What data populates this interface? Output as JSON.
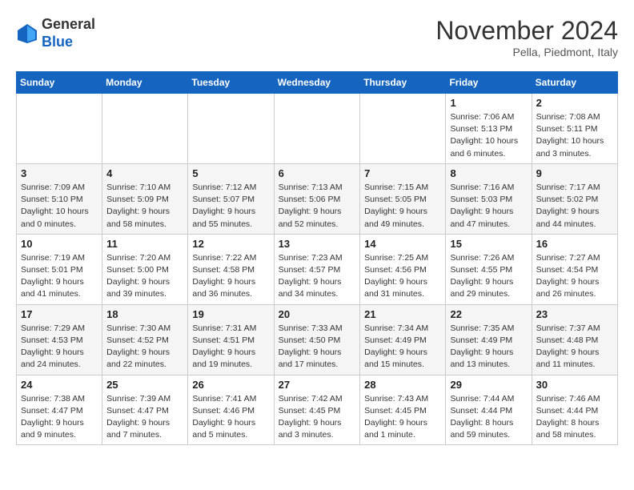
{
  "header": {
    "logo_line1": "General",
    "logo_line2": "Blue",
    "month": "November 2024",
    "location": "Pella, Piedmont, Italy"
  },
  "weekdays": [
    "Sunday",
    "Monday",
    "Tuesday",
    "Wednesday",
    "Thursday",
    "Friday",
    "Saturday"
  ],
  "weeks": [
    [
      {
        "day": "",
        "info": ""
      },
      {
        "day": "",
        "info": ""
      },
      {
        "day": "",
        "info": ""
      },
      {
        "day": "",
        "info": ""
      },
      {
        "day": "",
        "info": ""
      },
      {
        "day": "1",
        "info": "Sunrise: 7:06 AM\nSunset: 5:13 PM\nDaylight: 10 hours\nand 6 minutes."
      },
      {
        "day": "2",
        "info": "Sunrise: 7:08 AM\nSunset: 5:11 PM\nDaylight: 10 hours\nand 3 minutes."
      }
    ],
    [
      {
        "day": "3",
        "info": "Sunrise: 7:09 AM\nSunset: 5:10 PM\nDaylight: 10 hours\nand 0 minutes."
      },
      {
        "day": "4",
        "info": "Sunrise: 7:10 AM\nSunset: 5:09 PM\nDaylight: 9 hours\nand 58 minutes."
      },
      {
        "day": "5",
        "info": "Sunrise: 7:12 AM\nSunset: 5:07 PM\nDaylight: 9 hours\nand 55 minutes."
      },
      {
        "day": "6",
        "info": "Sunrise: 7:13 AM\nSunset: 5:06 PM\nDaylight: 9 hours\nand 52 minutes."
      },
      {
        "day": "7",
        "info": "Sunrise: 7:15 AM\nSunset: 5:05 PM\nDaylight: 9 hours\nand 49 minutes."
      },
      {
        "day": "8",
        "info": "Sunrise: 7:16 AM\nSunset: 5:03 PM\nDaylight: 9 hours\nand 47 minutes."
      },
      {
        "day": "9",
        "info": "Sunrise: 7:17 AM\nSunset: 5:02 PM\nDaylight: 9 hours\nand 44 minutes."
      }
    ],
    [
      {
        "day": "10",
        "info": "Sunrise: 7:19 AM\nSunset: 5:01 PM\nDaylight: 9 hours\nand 41 minutes."
      },
      {
        "day": "11",
        "info": "Sunrise: 7:20 AM\nSunset: 5:00 PM\nDaylight: 9 hours\nand 39 minutes."
      },
      {
        "day": "12",
        "info": "Sunrise: 7:22 AM\nSunset: 4:58 PM\nDaylight: 9 hours\nand 36 minutes."
      },
      {
        "day": "13",
        "info": "Sunrise: 7:23 AM\nSunset: 4:57 PM\nDaylight: 9 hours\nand 34 minutes."
      },
      {
        "day": "14",
        "info": "Sunrise: 7:25 AM\nSunset: 4:56 PM\nDaylight: 9 hours\nand 31 minutes."
      },
      {
        "day": "15",
        "info": "Sunrise: 7:26 AM\nSunset: 4:55 PM\nDaylight: 9 hours\nand 29 minutes."
      },
      {
        "day": "16",
        "info": "Sunrise: 7:27 AM\nSunset: 4:54 PM\nDaylight: 9 hours\nand 26 minutes."
      }
    ],
    [
      {
        "day": "17",
        "info": "Sunrise: 7:29 AM\nSunset: 4:53 PM\nDaylight: 9 hours\nand 24 minutes."
      },
      {
        "day": "18",
        "info": "Sunrise: 7:30 AM\nSunset: 4:52 PM\nDaylight: 9 hours\nand 22 minutes."
      },
      {
        "day": "19",
        "info": "Sunrise: 7:31 AM\nSunset: 4:51 PM\nDaylight: 9 hours\nand 19 minutes."
      },
      {
        "day": "20",
        "info": "Sunrise: 7:33 AM\nSunset: 4:50 PM\nDaylight: 9 hours\nand 17 minutes."
      },
      {
        "day": "21",
        "info": "Sunrise: 7:34 AM\nSunset: 4:49 PM\nDaylight: 9 hours\nand 15 minutes."
      },
      {
        "day": "22",
        "info": "Sunrise: 7:35 AM\nSunset: 4:49 PM\nDaylight: 9 hours\nand 13 minutes."
      },
      {
        "day": "23",
        "info": "Sunrise: 7:37 AM\nSunset: 4:48 PM\nDaylight: 9 hours\nand 11 minutes."
      }
    ],
    [
      {
        "day": "24",
        "info": "Sunrise: 7:38 AM\nSunset: 4:47 PM\nDaylight: 9 hours\nand 9 minutes."
      },
      {
        "day": "25",
        "info": "Sunrise: 7:39 AM\nSunset: 4:47 PM\nDaylight: 9 hours\nand 7 minutes."
      },
      {
        "day": "26",
        "info": "Sunrise: 7:41 AM\nSunset: 4:46 PM\nDaylight: 9 hours\nand 5 minutes."
      },
      {
        "day": "27",
        "info": "Sunrise: 7:42 AM\nSunset: 4:45 PM\nDaylight: 9 hours\nand 3 minutes."
      },
      {
        "day": "28",
        "info": "Sunrise: 7:43 AM\nSunset: 4:45 PM\nDaylight: 9 hours\nand 1 minute."
      },
      {
        "day": "29",
        "info": "Sunrise: 7:44 AM\nSunset: 4:44 PM\nDaylight: 8 hours\nand 59 minutes."
      },
      {
        "day": "30",
        "info": "Sunrise: 7:46 AM\nSunset: 4:44 PM\nDaylight: 8 hours\nand 58 minutes."
      }
    ]
  ]
}
